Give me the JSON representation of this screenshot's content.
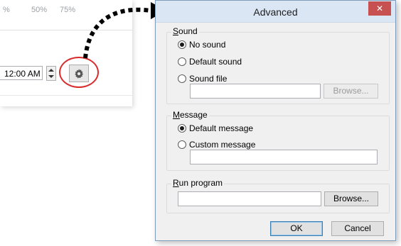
{
  "background_app": {
    "percent_labels": [
      "%",
      "50%",
      "75%"
    ],
    "time_value": "12:00 AM",
    "gear_icon": "gear-icon"
  },
  "dialog": {
    "title": "Advanced",
    "close_label": "✕",
    "sound": {
      "label_underline": "S",
      "label_rest": "ound",
      "options": [
        "No sound",
        "Default sound",
        "Sound file"
      ],
      "selected_index": 0,
      "browse_label": "Browse..."
    },
    "message": {
      "label_underline": "M",
      "label_rest": "essage",
      "options": [
        "Default message",
        "Custom message"
      ],
      "selected_index": 0
    },
    "run_program": {
      "label_underline": "R",
      "label_rest": "un program",
      "browse_label": "Browse..."
    },
    "ok_label": "OK",
    "cancel_label": "Cancel"
  },
  "colors": {
    "highlight_circle": "#d92c2c",
    "close_button": "#c75050",
    "titlebar": "#dbe6f4"
  }
}
